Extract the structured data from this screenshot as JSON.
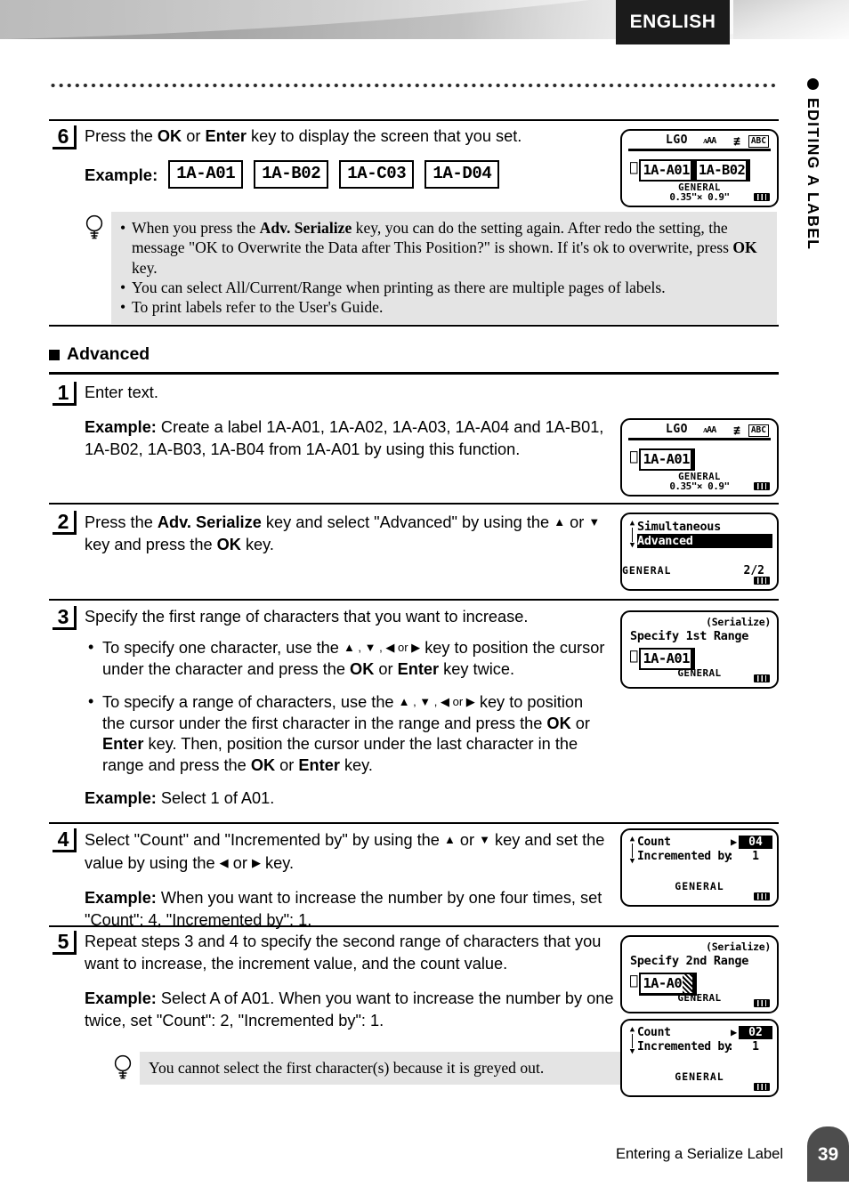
{
  "header": {
    "language_badge": "ENGLISH"
  },
  "side_tab": {
    "label": "EDITING A LABEL"
  },
  "step6": {
    "number": "6",
    "text_before": "Press the ",
    "ok": "OK",
    "mid1": " or ",
    "enter": "Enter",
    "text_after": " key to display the screen that you set.",
    "example_word": "Example:",
    "chips": [
      "1A-A01",
      "1A-B02",
      "1A-C03",
      "1A-D04"
    ],
    "notes": [
      "When you press the Adv. Serialize key, you can do the setting again. After redo the setting, the message \"OK to Overwrite the Data after This Position?\" is shown. If it's ok to overwrite, press OK key.",
      "You can select All/Current/Range when printing as there are multiple pages of labels.",
      "To print labels refer to the User's Guide."
    ],
    "note1_a": "When you press the ",
    "note1_b": "Adv. Serialize",
    "note1_c": " key, you can do the setting again. After redo the setting, the message \"OK to Overwrite the Data after This Position?\" is shown. If it's ok to overwrite, press ",
    "note1_d": "OK",
    "note1_e": " key.",
    "note2": "You can select All/Current/Range when printing as there are multiple pages of labels.",
    "note3": "To print labels refer to the User's Guide."
  },
  "section": {
    "heading": "Advanced"
  },
  "step1": {
    "number": "1",
    "text": "Enter text.",
    "example_word": "Example:",
    "example_text": " Create a label 1A-A01, 1A-A02, 1A-A03, 1A-A04 and 1A-B01, 1A-B02, 1A-B03, 1A-B04 from 1A-A01 by using this function."
  },
  "step2": {
    "number": "2",
    "a": "Press the ",
    "b": "Adv. Serialize",
    "c": " key and select \"Advanced\" by using the ",
    "up": "▲",
    "d": " or ",
    "down": "▼",
    "e": " key and press the ",
    "ok": "OK",
    "f": " key."
  },
  "step3": {
    "number": "3",
    "text": "Specify the first range of characters that you want to increase.",
    "bullet1_a": "To specify one character, use the ",
    "bullet1_keys": "▲ , ▼ , ◀ or ▶",
    "bullet1_b": " key to position the cursor under the character and press the ",
    "bullet1_ok": "OK",
    "bullet1_c": " or ",
    "bullet1_enter": "Enter",
    "bullet1_d": " key twice.",
    "bullet2_a": "To specify a range of characters, use the ",
    "bullet2_keys": "▲ , ▼ , ◀ or ▶",
    "bullet2_b": " key to position the cursor under the first character in the range and press the ",
    "bullet2_ok": "OK",
    "bullet2_c": " or ",
    "bullet2_enter": "Enter",
    "bullet2_d": " key. Then, position the cursor under the last character in the range and press the ",
    "bullet2_ok2": "OK",
    "bullet2_e": " or ",
    "bullet2_enter2": "Enter",
    "bullet2_f": " key.",
    "example_word": "Example:",
    "example_text": " Select 1 of A01."
  },
  "step4": {
    "number": "4",
    "a": "Select \"Count\" and \"Incremented by\" by using the ",
    "up": "▲",
    "b": " or ",
    "down": "▼",
    "c": " key and set the value by using the ",
    "left": "◀",
    "d": " or ",
    "right": "▶",
    "e": " key.",
    "example_word": "Example:",
    "example_text": " When you want to increase the number by one four times, set \"Count\": 4, \"Incremented by\": 1."
  },
  "step5": {
    "number": "5",
    "text": "Repeat steps 3 and 4 to specify the second range of characters that you want to increase, the increment value, and the count value.",
    "example_word": "Example:",
    "example_text": " Select A of A01. When you want to increase the number by one twice, set \"Count\": 2, \"Incremented by\": 1.",
    "note": "You cannot select the first character(s) because it is greyed out."
  },
  "lcd": {
    "screen1": {
      "logo": "LGO",
      "sizes": "ᴀAA",
      "align_icon": "align-icon",
      "abc": "ABC",
      "return_mark": "↵",
      "field1": "1A-A01",
      "field2": "1A-B02",
      "general": "GENERAL",
      "size": "0.35\"× 0.9\"",
      "battery": "battery-full"
    },
    "screen2": {
      "logo": "LGO",
      "sizes": "ᴀAA",
      "abc": "ABC",
      "return_mark": "↵",
      "field1": "1A-A01",
      "general": "GENERAL",
      "size": "0.35\"× 0.9\""
    },
    "screen3": {
      "item1": "Simultaneous",
      "item2": "Advanced",
      "general": "GENERAL",
      "page": "2/2"
    },
    "screen4": {
      "corner_title": "(Serialize)",
      "prompt": "Specify 1st Range",
      "return_mark": "↵",
      "field": "1A-A01",
      "general": "GENERAL"
    },
    "screen5": {
      "label1": "Count",
      "label2": "Incremented by",
      "value1": "04",
      "value2": "1",
      "general": "GENERAL"
    },
    "screen6": {
      "corner_title": "(Serialize)",
      "prompt": "Specify 2nd Range",
      "return_mark": "↵",
      "field": "1A-A0",
      "general": "GENERAL"
    },
    "screen7": {
      "label1": "Count",
      "label2": "Incremented by",
      "value1": "02",
      "value2": "1",
      "general": "GENERAL"
    }
  },
  "footer": {
    "caption": "Entering a Serialize Label",
    "page_number": "39"
  }
}
